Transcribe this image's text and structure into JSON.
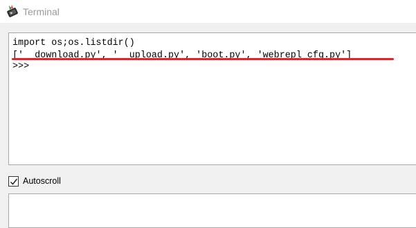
{
  "window": {
    "title": "Terminal",
    "icon": "terminal-app-icon"
  },
  "terminal": {
    "lines": [
      "import os;os.listdir()",
      "['__download.py', '__upload.py', 'boot.py', 'webrepl_cfg.py']",
      ">>>"
    ],
    "highlight_color": "#e8202a"
  },
  "autoscroll": {
    "label": "Autoscroll",
    "checked": true
  },
  "input": {
    "value": ""
  }
}
